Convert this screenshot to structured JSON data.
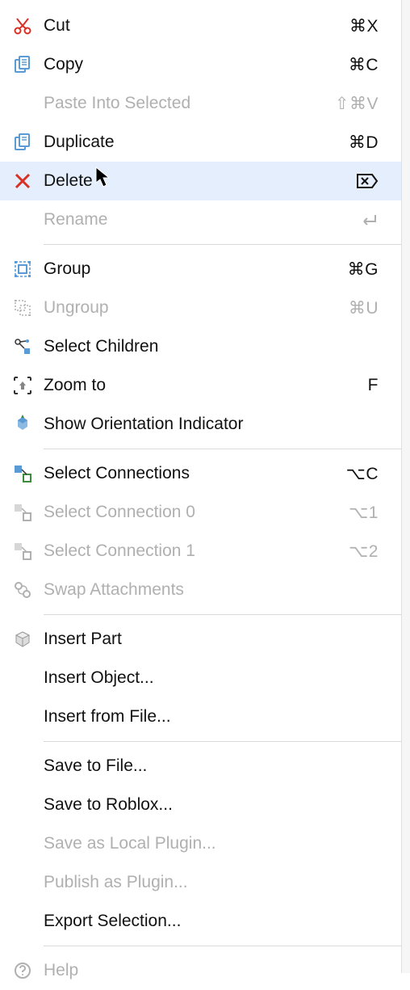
{
  "items": [
    {
      "label": "Cut",
      "shortcut": "⌘X",
      "icon": "cut",
      "enabled": true
    },
    {
      "label": "Copy",
      "shortcut": "⌘C",
      "icon": "copy",
      "enabled": true
    },
    {
      "label": "Paste Into Selected",
      "shortcut": "⇧⌘V",
      "icon": null,
      "enabled": false
    },
    {
      "label": "Duplicate",
      "shortcut": "⌘D",
      "icon": "duplicate",
      "enabled": true
    },
    {
      "label": "Delete",
      "shortcut": "⌦",
      "icon": "delete",
      "enabled": true,
      "hover": true
    },
    {
      "label": "Rename",
      "shortcut": "↩",
      "icon": null,
      "enabled": false
    },
    {
      "sep": true
    },
    {
      "label": "Group",
      "shortcut": "⌘G",
      "icon": "group",
      "enabled": true
    },
    {
      "label": "Ungroup",
      "shortcut": "⌘U",
      "icon": "ungroup",
      "enabled": false
    },
    {
      "label": "Select Children",
      "shortcut": "",
      "icon": "select-children",
      "enabled": true
    },
    {
      "label": "Zoom to",
      "shortcut": "F",
      "icon": "zoom-to",
      "enabled": true
    },
    {
      "label": "Show Orientation Indicator",
      "shortcut": "",
      "icon": "orientation",
      "enabled": true
    },
    {
      "sep": true
    },
    {
      "label": "Select Connections",
      "shortcut": "⌥C",
      "icon": "select-connections",
      "enabled": true
    },
    {
      "label": "Select Connection 0",
      "shortcut": "⌥1",
      "icon": "select-connection-0",
      "enabled": false
    },
    {
      "label": "Select Connection 1",
      "shortcut": "⌥2",
      "icon": "select-connection-1",
      "enabled": false
    },
    {
      "label": "Swap Attachments",
      "shortcut": "",
      "icon": "swap-attachments",
      "enabled": false
    },
    {
      "sep": true
    },
    {
      "label": "Insert Part",
      "shortcut": "",
      "icon": "insert-part",
      "enabled": true
    },
    {
      "label": "Insert Object...",
      "shortcut": "",
      "icon": null,
      "enabled": true
    },
    {
      "label": "Insert from File...",
      "shortcut": "",
      "icon": null,
      "enabled": true
    },
    {
      "sep": true
    },
    {
      "label": "Save to File...",
      "shortcut": "",
      "icon": null,
      "enabled": true
    },
    {
      "label": "Save to Roblox...",
      "shortcut": "",
      "icon": null,
      "enabled": true
    },
    {
      "label": "Save as Local Plugin...",
      "shortcut": "",
      "icon": null,
      "enabled": false
    },
    {
      "label": "Publish as Plugin...",
      "shortcut": "",
      "icon": null,
      "enabled": false
    },
    {
      "label": "Export Selection...",
      "shortcut": "",
      "icon": null,
      "enabled": true
    },
    {
      "sep": true
    },
    {
      "label": "Help",
      "shortcut": "",
      "icon": "help",
      "enabled": false
    }
  ],
  "icon_colors": {
    "blue": "#5a9bd5",
    "red": "#d93025",
    "gray": "#b0b0b0",
    "dark": "#333333",
    "green": "#3c8c3c"
  }
}
